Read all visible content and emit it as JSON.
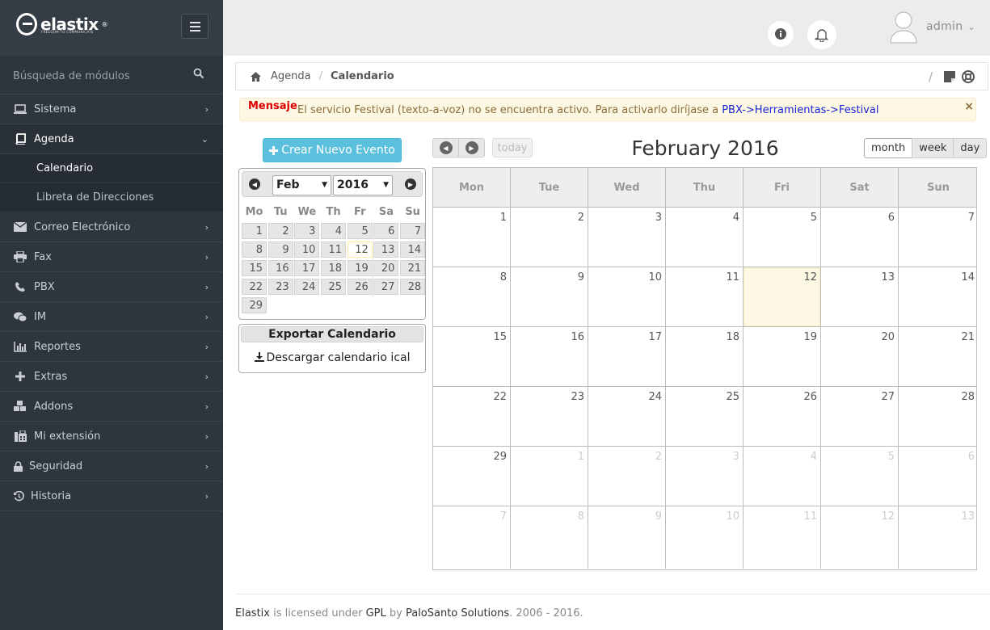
{
  "brand": {
    "name": "elastix",
    "tagline": "FREEDOM TO COMMUNICATE",
    "reg": "®"
  },
  "sidebar": {
    "search_placeholder": "Búsqueda de módulos",
    "items": [
      {
        "label": "Sistema",
        "icon": "laptop-icon"
      },
      {
        "label": "Agenda",
        "icon": "book-icon"
      },
      {
        "label": "Correo Electrónico",
        "icon": "envelope-icon"
      },
      {
        "label": "Fax",
        "icon": "printer-icon"
      },
      {
        "label": "PBX",
        "icon": "phone-icon"
      },
      {
        "label": "IM",
        "icon": "chat-icon"
      },
      {
        "label": "Reportes",
        "icon": "bar-chart-icon"
      },
      {
        "label": "Extras",
        "icon": "plus-icon"
      },
      {
        "label": "Addons",
        "icon": "cubes-icon"
      },
      {
        "label": "Mi extensión",
        "icon": "fax-phone-icon"
      },
      {
        "label": "Seguridad",
        "icon": "lock-icon"
      },
      {
        "label": "Historia",
        "icon": "history-icon"
      }
    ],
    "subitems": [
      {
        "label": "Calendario"
      },
      {
        "label": "Libreta de Direcciones"
      }
    ]
  },
  "topbar": {
    "user": "admin"
  },
  "breadcrumb": {
    "parent": "Agenda",
    "current": "Calendario"
  },
  "alert": {
    "label": "Mensaje",
    "message": "El servicio Festival (texto-a-voz) no se encuentra activo. Para activarlo diríjase a ",
    "link": "PBX->Herramientas->Festival",
    "close": "×"
  },
  "create_event": "Crear Nuevo Evento",
  "mini_calendar": {
    "month": "Feb",
    "year": "2016",
    "dow": [
      "Mo",
      "Tu",
      "We",
      "Th",
      "Fr",
      "Sa",
      "Su"
    ],
    "weeks": [
      [
        "1",
        "2",
        "3",
        "4",
        "5",
        "6",
        "7"
      ],
      [
        "8",
        "9",
        "10",
        "11",
        "12",
        "13",
        "14"
      ],
      [
        "15",
        "16",
        "17",
        "18",
        "19",
        "20",
        "21"
      ],
      [
        "22",
        "23",
        "24",
        "25",
        "26",
        "27",
        "28"
      ],
      [
        "29"
      ]
    ],
    "today": "12"
  },
  "export": {
    "title": "Exportar Calendario",
    "link": "Descargar calendario ical"
  },
  "calendar": {
    "today_label": "today",
    "title": "February 2016",
    "views": [
      "month",
      "week",
      "day"
    ],
    "active_view": "month",
    "dow": [
      "Mon",
      "Tue",
      "Wed",
      "Thu",
      "Fri",
      "Sat",
      "Sun"
    ],
    "weeks": [
      [
        "1",
        "2",
        "3",
        "4",
        "5",
        "6",
        "7"
      ],
      [
        "8",
        "9",
        "10",
        "11",
        "12",
        "13",
        "14"
      ],
      [
        "15",
        "16",
        "17",
        "18",
        "19",
        "20",
        "21"
      ],
      [
        "22",
        "23",
        "24",
        "25",
        "26",
        "27",
        "28"
      ],
      [
        "29",
        "1",
        "2",
        "3",
        "4",
        "5",
        "6"
      ],
      [
        "7",
        "8",
        "9",
        "10",
        "11",
        "12",
        "13"
      ]
    ]
  },
  "footer": {
    "product": "Elastix",
    "t1": " is licensed under ",
    "license": "GPL",
    "t2": " by ",
    "company": "PaloSanto Solutions",
    "t3": ". 2006 - 2016."
  }
}
